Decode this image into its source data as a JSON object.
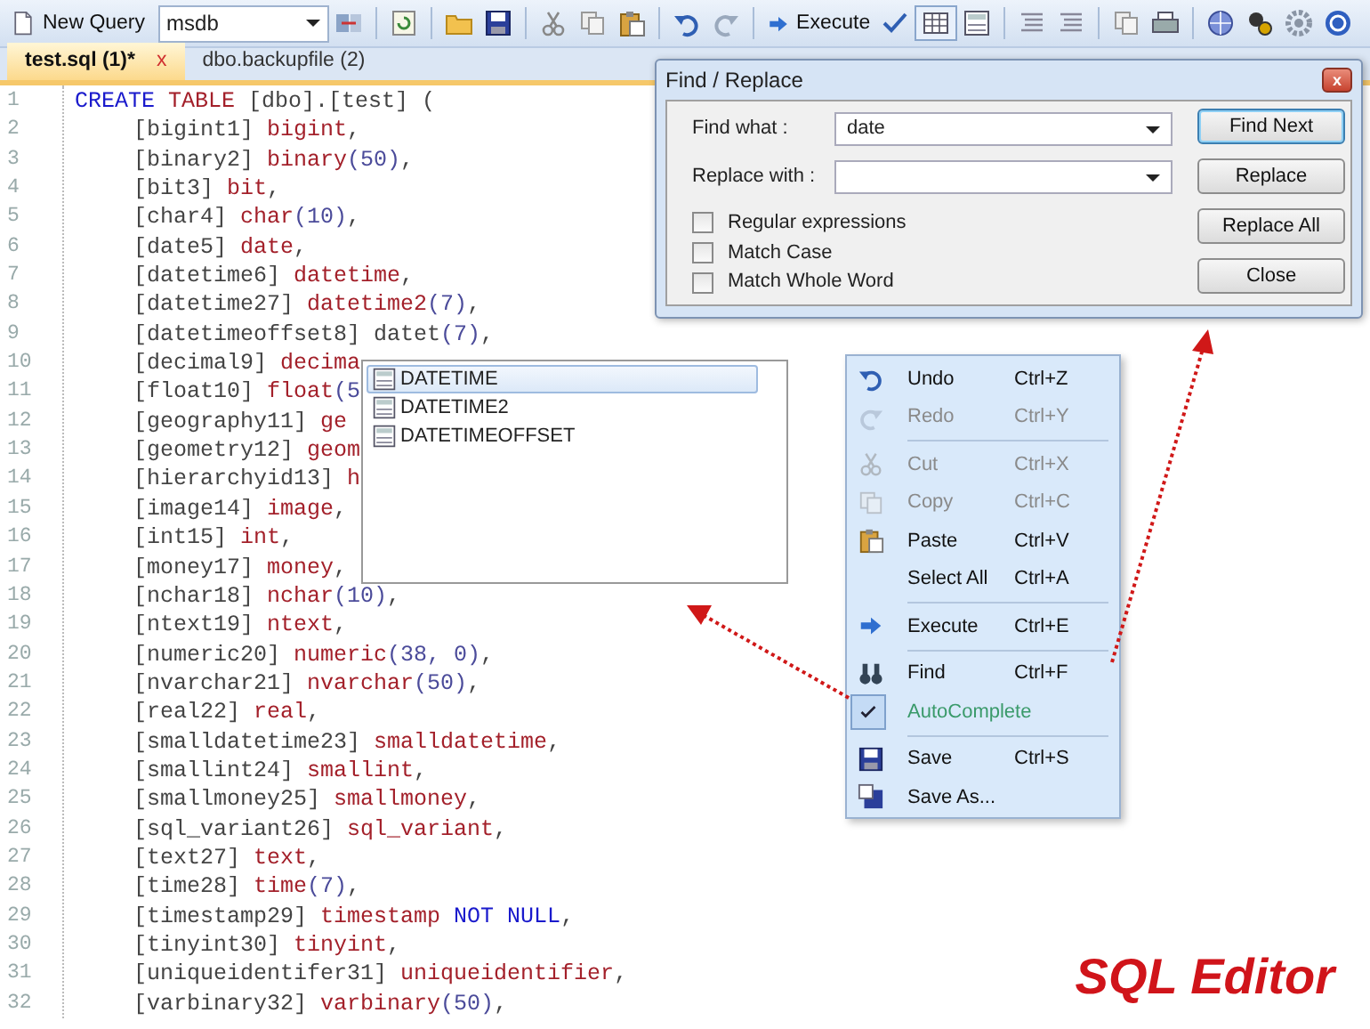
{
  "toolbar": {
    "new_query_label": "New Query",
    "database": "msdb",
    "execute_label": "Execute"
  },
  "tabs": [
    {
      "label": "test.sql (1)*",
      "selected": true,
      "close": "x"
    },
    {
      "label": "dbo.backupfile (2)",
      "selected": false
    }
  ],
  "editor": {
    "lines": [
      {
        "number": "1",
        "kind": "statement",
        "tokens": [
          {
            "text": "CREATE ",
            "kind": "keyword"
          },
          {
            "text": "TABLE ",
            "kind": "type"
          },
          {
            "text": "[dbo].[test] (",
            "kind": "plain"
          }
        ]
      },
      {
        "number": "2",
        "kind": "column",
        "tokens": [
          {
            "text": "[bigint1] ",
            "kind": "plain"
          },
          {
            "text": "bigint",
            "kind": "type"
          },
          {
            "text": ",",
            "kind": "plain"
          }
        ]
      },
      {
        "number": "3",
        "kind": "column",
        "tokens": [
          {
            "text": "[binary2] ",
            "kind": "plain"
          },
          {
            "text": "binary",
            "kind": "type"
          },
          {
            "text": "(50)",
            "kind": "number"
          },
          {
            "text": ",",
            "kind": "plain"
          }
        ]
      },
      {
        "number": "4",
        "kind": "column",
        "tokens": [
          {
            "text": "[bit3] ",
            "kind": "plain"
          },
          {
            "text": "bit",
            "kind": "type"
          },
          {
            "text": ",",
            "kind": "plain"
          }
        ]
      },
      {
        "number": "5",
        "kind": "column",
        "tokens": [
          {
            "text": "[char4] ",
            "kind": "plain"
          },
          {
            "text": "char",
            "kind": "type"
          },
          {
            "text": "(10)",
            "kind": "number"
          },
          {
            "text": ",",
            "kind": "plain"
          }
        ]
      },
      {
        "number": "6",
        "kind": "column",
        "tokens": [
          {
            "text": "[date5] ",
            "kind": "plain"
          },
          {
            "text": "date",
            "kind": "type"
          },
          {
            "text": ",",
            "kind": "plain"
          }
        ]
      },
      {
        "number": "7",
        "kind": "column",
        "tokens": [
          {
            "text": "[datetime6] ",
            "kind": "plain"
          },
          {
            "text": "datetime",
            "kind": "type"
          },
          {
            "text": ",",
            "kind": "plain"
          }
        ]
      },
      {
        "number": "8",
        "kind": "column",
        "tokens": [
          {
            "text": "[datetime27] ",
            "kind": "plain"
          },
          {
            "text": "datetime2",
            "kind": "type"
          },
          {
            "text": "(7)",
            "kind": "number"
          },
          {
            "text": ",",
            "kind": "plain"
          }
        ]
      },
      {
        "number": "9",
        "kind": "column",
        "tokens": [
          {
            "text": "[datetimeoffset8] datet",
            "kind": "plain"
          },
          {
            "text": "(7)",
            "kind": "number"
          },
          {
            "text": ",",
            "kind": "plain"
          }
        ]
      },
      {
        "number": "10",
        "kind": "column",
        "tokens": [
          {
            "text": "[decimal9] ",
            "kind": "plain"
          },
          {
            "text": "decima",
            "kind": "type"
          }
        ]
      },
      {
        "number": "11",
        "kind": "column",
        "tokens": [
          {
            "text": "[float10] ",
            "kind": "plain"
          },
          {
            "text": "float",
            "kind": "type"
          },
          {
            "text": "(5",
            "kind": "number"
          }
        ]
      },
      {
        "number": "12",
        "kind": "column",
        "tokens": [
          {
            "text": "[geography11] ",
            "kind": "plain"
          },
          {
            "text": "ge",
            "kind": "type"
          }
        ]
      },
      {
        "number": "13",
        "kind": "column",
        "tokens": [
          {
            "text": "[geometry12] ",
            "kind": "plain"
          },
          {
            "text": "geom",
            "kind": "type"
          }
        ]
      },
      {
        "number": "14",
        "kind": "column",
        "tokens": [
          {
            "text": "[hierarchyid13] ",
            "kind": "plain"
          },
          {
            "text": "h",
            "kind": "type"
          }
        ]
      },
      {
        "number": "15",
        "kind": "column",
        "tokens": [
          {
            "text": "[image14] ",
            "kind": "plain"
          },
          {
            "text": "image",
            "kind": "type"
          },
          {
            "text": ",",
            "kind": "plain"
          }
        ]
      },
      {
        "number": "16",
        "kind": "column",
        "tokens": [
          {
            "text": "[int15] ",
            "kind": "plain"
          },
          {
            "text": "int",
            "kind": "type"
          },
          {
            "text": ",",
            "kind": "plain"
          }
        ]
      },
      {
        "number": "17",
        "kind": "column",
        "tokens": [
          {
            "text": "[money17] ",
            "kind": "plain"
          },
          {
            "text": "money",
            "kind": "type"
          },
          {
            "text": ",",
            "kind": "plain"
          }
        ]
      },
      {
        "number": "18",
        "kind": "column",
        "tokens": [
          {
            "text": "[nchar18] ",
            "kind": "plain"
          },
          {
            "text": "nchar",
            "kind": "type"
          },
          {
            "text": "(10)",
            "kind": "number"
          },
          {
            "text": ",",
            "kind": "plain"
          }
        ]
      },
      {
        "number": "19",
        "kind": "column",
        "tokens": [
          {
            "text": "[ntext19] ",
            "kind": "plain"
          },
          {
            "text": "ntext",
            "kind": "type"
          },
          {
            "text": ",",
            "kind": "plain"
          }
        ]
      },
      {
        "number": "20",
        "kind": "column",
        "tokens": [
          {
            "text": "[numeric20] ",
            "kind": "plain"
          },
          {
            "text": "numeric",
            "kind": "type"
          },
          {
            "text": "(38, 0)",
            "kind": "number"
          },
          {
            "text": ",",
            "kind": "plain"
          }
        ]
      },
      {
        "number": "21",
        "kind": "column",
        "tokens": [
          {
            "text": "[nvarchar21] ",
            "kind": "plain"
          },
          {
            "text": "nvarchar",
            "kind": "type"
          },
          {
            "text": "(50)",
            "kind": "number"
          },
          {
            "text": ",",
            "kind": "plain"
          }
        ]
      },
      {
        "number": "22",
        "kind": "column",
        "tokens": [
          {
            "text": "[real22] ",
            "kind": "plain"
          },
          {
            "text": "real",
            "kind": "type"
          },
          {
            "text": ",",
            "kind": "plain"
          }
        ]
      },
      {
        "number": "23",
        "kind": "column",
        "tokens": [
          {
            "text": "[smalldatetime23] ",
            "kind": "plain"
          },
          {
            "text": "smalldatetime",
            "kind": "type"
          },
          {
            "text": ",",
            "kind": "plain"
          }
        ]
      },
      {
        "number": "24",
        "kind": "column",
        "tokens": [
          {
            "text": "[smallint24] ",
            "kind": "plain"
          },
          {
            "text": "smallint",
            "kind": "type"
          },
          {
            "text": ",",
            "kind": "plain"
          }
        ]
      },
      {
        "number": "25",
        "kind": "column",
        "tokens": [
          {
            "text": "[smallmoney25] ",
            "kind": "plain"
          },
          {
            "text": "smallmoney",
            "kind": "type"
          },
          {
            "text": ",",
            "kind": "plain"
          }
        ]
      },
      {
        "number": "26",
        "kind": "column",
        "tokens": [
          {
            "text": "[sql_variant26] ",
            "kind": "plain"
          },
          {
            "text": "sql_variant",
            "kind": "type"
          },
          {
            "text": ",",
            "kind": "plain"
          }
        ]
      },
      {
        "number": "27",
        "kind": "column",
        "tokens": [
          {
            "text": "[text27] ",
            "kind": "plain"
          },
          {
            "text": "text",
            "kind": "type"
          },
          {
            "text": ",",
            "kind": "plain"
          }
        ]
      },
      {
        "number": "28",
        "kind": "column",
        "tokens": [
          {
            "text": "[time28] ",
            "kind": "plain"
          },
          {
            "text": "time",
            "kind": "type"
          },
          {
            "text": "(7)",
            "kind": "number"
          },
          {
            "text": ",",
            "kind": "plain"
          }
        ]
      },
      {
        "number": "29",
        "kind": "column",
        "tokens": [
          {
            "text": "[timestamp29] ",
            "kind": "plain"
          },
          {
            "text": "timestamp ",
            "kind": "type"
          },
          {
            "text": "NOT NULL",
            "kind": "keyword"
          },
          {
            "text": ",",
            "kind": "plain"
          }
        ]
      },
      {
        "number": "30",
        "kind": "column",
        "tokens": [
          {
            "text": "[tinyint30] ",
            "kind": "plain"
          },
          {
            "text": "tinyint",
            "kind": "type"
          },
          {
            "text": ",",
            "kind": "plain"
          }
        ]
      },
      {
        "number": "31",
        "kind": "column",
        "tokens": [
          {
            "text": "[uniqueidentifer31] ",
            "kind": "plain"
          },
          {
            "text": "uniqueidentifier",
            "kind": "type"
          },
          {
            "text": ",",
            "kind": "plain"
          }
        ]
      },
      {
        "number": "32",
        "kind": "column",
        "tokens": [
          {
            "text": "[varbinary32] ",
            "kind": "plain"
          },
          {
            "text": "varbinary",
            "kind": "type"
          },
          {
            "text": "(50)",
            "kind": "number"
          },
          {
            "text": ",",
            "kind": "plain"
          }
        ]
      }
    ]
  },
  "autocomplete": {
    "items": [
      {
        "label": "DATETIME",
        "selected": true
      },
      {
        "label": "DATETIME2",
        "selected": false
      },
      {
        "label": "DATETIMEOFFSET",
        "selected": false
      }
    ]
  },
  "find_replace": {
    "title": "Find / Replace",
    "close": "x",
    "find_what": {
      "label": "Find what :",
      "value": "date"
    },
    "replace_with": {
      "label": "Replace with :"
    },
    "options": [
      {
        "label": "Regular expressions",
        "checked": false
      },
      {
        "label": "Match Case",
        "checked": false
      },
      {
        "label": "Match Whole Word",
        "checked": false
      }
    ],
    "buttons": [
      {
        "label": "Find Next",
        "default": true
      },
      {
        "label": "Replace",
        "default": false
      },
      {
        "label": "Replace All",
        "default": false
      },
      {
        "label": "Close",
        "default": false
      }
    ]
  },
  "context_menu": {
    "items": [
      {
        "kind": "item",
        "label": "Undo",
        "shortcut": "Ctrl+Z",
        "disabled": false,
        "checked": false
      },
      {
        "kind": "item",
        "label": "Redo",
        "shortcut": "Ctrl+Y",
        "disabled": true,
        "checked": false
      },
      {
        "kind": "separator"
      },
      {
        "kind": "item",
        "label": "Cut",
        "shortcut": "Ctrl+X",
        "disabled": true,
        "checked": false
      },
      {
        "kind": "item",
        "label": "Copy",
        "shortcut": "Ctrl+C",
        "disabled": true,
        "checked": false
      },
      {
        "kind": "item",
        "label": "Paste",
        "shortcut": "Ctrl+V",
        "disabled": false,
        "checked": false
      },
      {
        "kind": "item",
        "label": "Select All",
        "shortcut": "Ctrl+A",
        "disabled": false,
        "checked": false
      },
      {
        "kind": "separator"
      },
      {
        "kind": "item",
        "label": "Execute",
        "shortcut": "Ctrl+E",
        "disabled": false,
        "checked": false
      },
      {
        "kind": "separator"
      },
      {
        "kind": "item",
        "label": "Find",
        "shortcut": "Ctrl+F",
        "disabled": false,
        "checked": false
      },
      {
        "kind": "item",
        "label": "AutoComplete",
        "disabled": false,
        "checked": true
      },
      {
        "kind": "separator"
      },
      {
        "kind": "item",
        "label": "Save",
        "shortcut": "Ctrl+S",
        "disabled": false,
        "checked": false
      },
      {
        "kind": "item",
        "label": "Save As...",
        "disabled": false,
        "checked": false
      }
    ]
  },
  "caption": "SQL Editor"
}
